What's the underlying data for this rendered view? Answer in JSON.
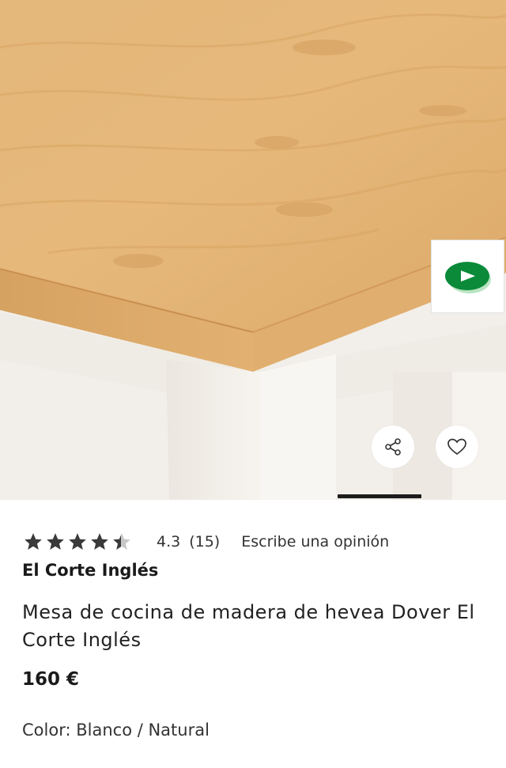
{
  "product": {
    "rating_value": "4.3",
    "rating_count": "(15)",
    "rating_stars": 4.3,
    "write_review_label": "Escribe una opinión",
    "brand": "El Corte Inglés",
    "title": "Mesa de cocina de madera de hevea Dover El Corte Inglés",
    "price": "160 €",
    "color_label": "Color:",
    "color_value": "Blanco / Natural"
  },
  "gallery": {
    "active_slide_indicator": "visible",
    "icons": [
      "play-video-icon",
      "share-icon",
      "heart-icon"
    ]
  },
  "colors": {
    "accent_green": "#0b8a3a",
    "text": "#222222",
    "star": "#3a3a3a"
  }
}
